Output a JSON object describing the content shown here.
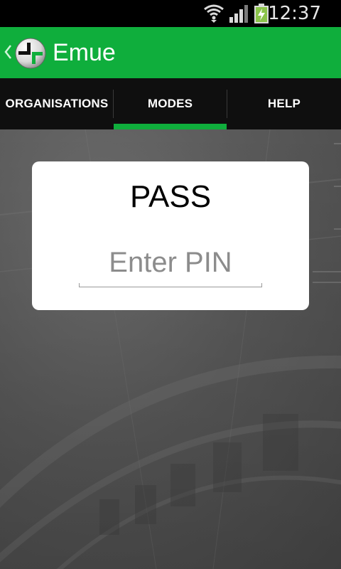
{
  "status_bar": {
    "time": "12:37",
    "icons": [
      "wifi-icon",
      "signal-icon",
      "battery-charging-icon"
    ]
  },
  "action_bar": {
    "title": "Emue",
    "logo_icon": "emue-logo-icon",
    "back_icon": "chevron-left-icon",
    "color": "#0fae3c"
  },
  "tabs": [
    {
      "label": "ORGANISATIONS",
      "selected": false
    },
    {
      "label": "MODES",
      "selected": true
    },
    {
      "label": "HELP",
      "selected": false
    }
  ],
  "card": {
    "mode": "PASS",
    "pin_placeholder": "Enter PIN",
    "pin_value": ""
  }
}
